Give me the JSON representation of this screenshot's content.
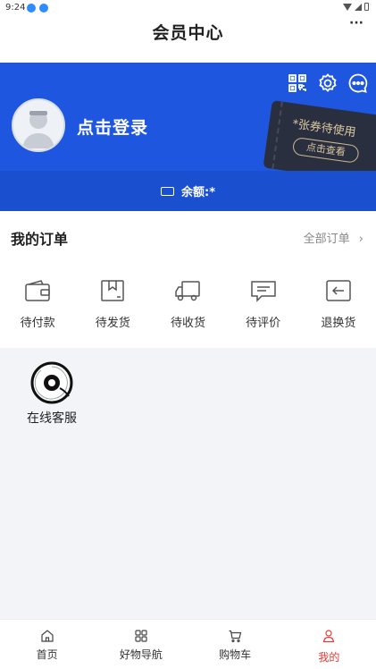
{
  "status_bar": {
    "time": "9:24"
  },
  "header": {
    "title": "会员中心",
    "more": "···"
  },
  "profile": {
    "login_label": "点击登录"
  },
  "coupon": {
    "text": "*张券待使用",
    "button": "点击查看"
  },
  "balance": {
    "label": "余额:*"
  },
  "orders": {
    "title": "我的订单",
    "all_label": "全部订单",
    "items": [
      {
        "label": "待付款",
        "icon": "wallet-icon"
      },
      {
        "label": "待发货",
        "icon": "package-icon"
      },
      {
        "label": "待收货",
        "icon": "truck-icon"
      },
      {
        "label": "待评价",
        "icon": "comment-icon"
      },
      {
        "label": "退换货",
        "icon": "return-icon"
      }
    ]
  },
  "service": {
    "label": "在线客服"
  },
  "tabbar": {
    "items": [
      {
        "label": "首页",
        "icon": "home-icon"
      },
      {
        "label": "好物导航",
        "icon": "grid-icon"
      },
      {
        "label": "购物车",
        "icon": "cart-icon"
      },
      {
        "label": "我的",
        "icon": "user-icon",
        "active": true
      }
    ]
  },
  "colors": {
    "primary": "#1f56e0",
    "active_tab": "#e53935"
  }
}
